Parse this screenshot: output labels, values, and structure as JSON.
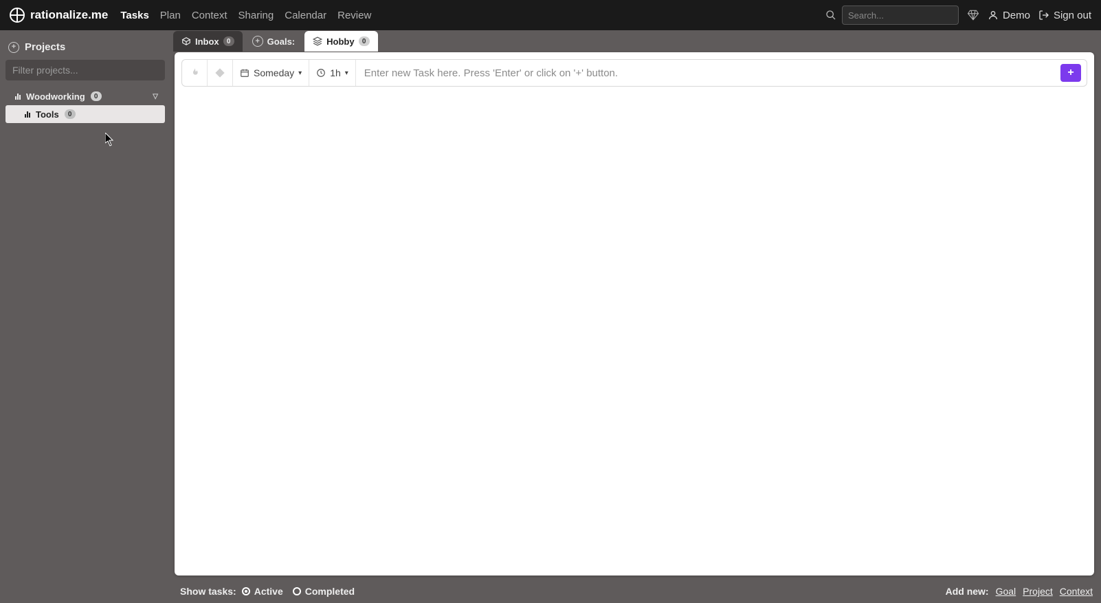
{
  "brand": "rationalize.me",
  "nav": {
    "items": [
      "Tasks",
      "Plan",
      "Context",
      "Sharing",
      "Calendar",
      "Review"
    ],
    "active_index": 0
  },
  "search": {
    "placeholder": "Search..."
  },
  "user": {
    "name": "Demo",
    "signout": "Sign out"
  },
  "sidebar": {
    "title": "Projects",
    "filter_placeholder": "Filter projects...",
    "projects": [
      {
        "name": "Woodworking",
        "count": "0",
        "level": 0,
        "expanded": true,
        "active": false
      },
      {
        "name": "Tools",
        "count": "0",
        "level": 1,
        "expanded": false,
        "active": true
      }
    ]
  },
  "tabs": {
    "inbox": {
      "label": "Inbox",
      "count": "0"
    },
    "goals_label": "Goals:",
    "goal": {
      "label": "Hobby",
      "count": "0"
    }
  },
  "new_task": {
    "someday": "Someday",
    "duration": "1h",
    "placeholder": "Enter new Task here. Press 'Enter' or click on '+' button.",
    "add": "+"
  },
  "footer": {
    "show_label": "Show tasks:",
    "options": [
      "Active",
      "Completed"
    ],
    "selected_index": 0,
    "addnew_label": "Add new:",
    "links": [
      "Goal",
      "Project",
      "Context"
    ]
  }
}
